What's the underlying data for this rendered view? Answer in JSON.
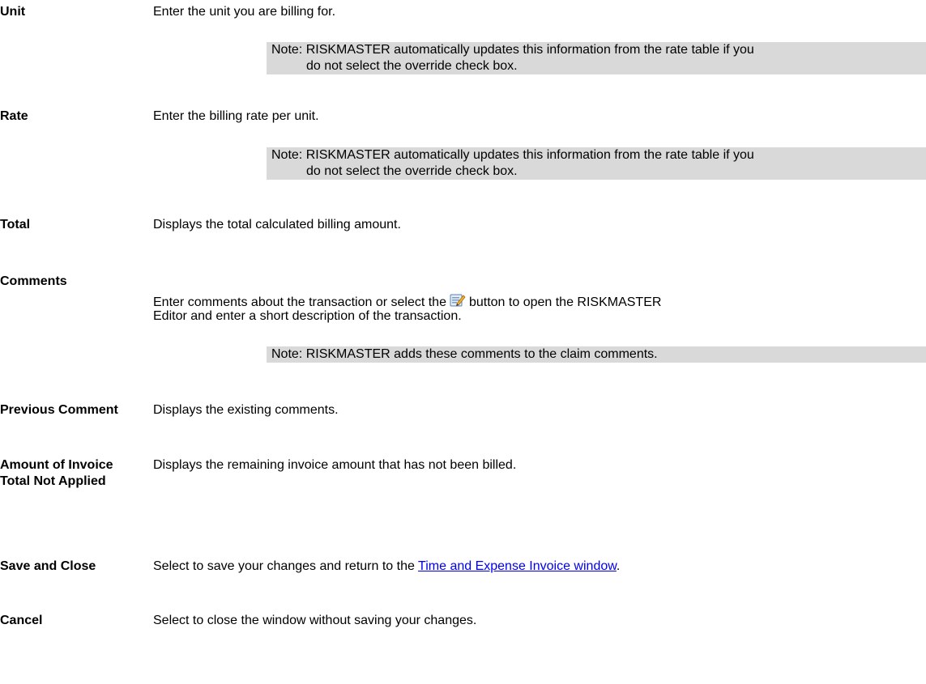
{
  "fields": {
    "unit": {
      "label": "Unit",
      "description": "Enter the unit you are billing for.",
      "note_line1": "Note: RISKMASTER automatically updates this information from the rate table if you",
      "note_line2": "do not select the override check box."
    },
    "rate": {
      "label": "Rate",
      "description": "Enter the billing rate per unit.",
      "note_line1": "Note: RISKMASTER automatically updates this information from the rate table if you",
      "note_line2": "do not select the override check box."
    },
    "total": {
      "label": "Total",
      "description": "Displays the total calculated billing amount."
    },
    "comments": {
      "label": "Comments",
      "description_part1": "Enter comments about the transaction or select the",
      "description_part2": "button to open the RISKMASTER",
      "description_line2": "Editor and enter a short description of the transaction.",
      "note": "Note: RISKMASTER adds these comments to the claim comments."
    },
    "previous_comment": {
      "label": "Previous Comment",
      "description": "Displays the existing comments."
    },
    "amount_not_applied": {
      "label_line1": "Amount of Invoice",
      "label_line2": "Total Not Applied",
      "description": "Displays the remaining invoice amount that has not been billed."
    },
    "save_and_close": {
      "label": "Save and Close",
      "description_before": "Select to save your changes and return to the",
      "link_text": "Time and Expense Invoice window",
      "description_after": "."
    },
    "cancel": {
      "label": "Cancel",
      "description": "Select to close the window without saving your changes."
    }
  },
  "icons": {
    "editor_button": "editor-icon"
  },
  "colors": {
    "note_background": "#d9d9d9",
    "link": "#0000ee"
  }
}
